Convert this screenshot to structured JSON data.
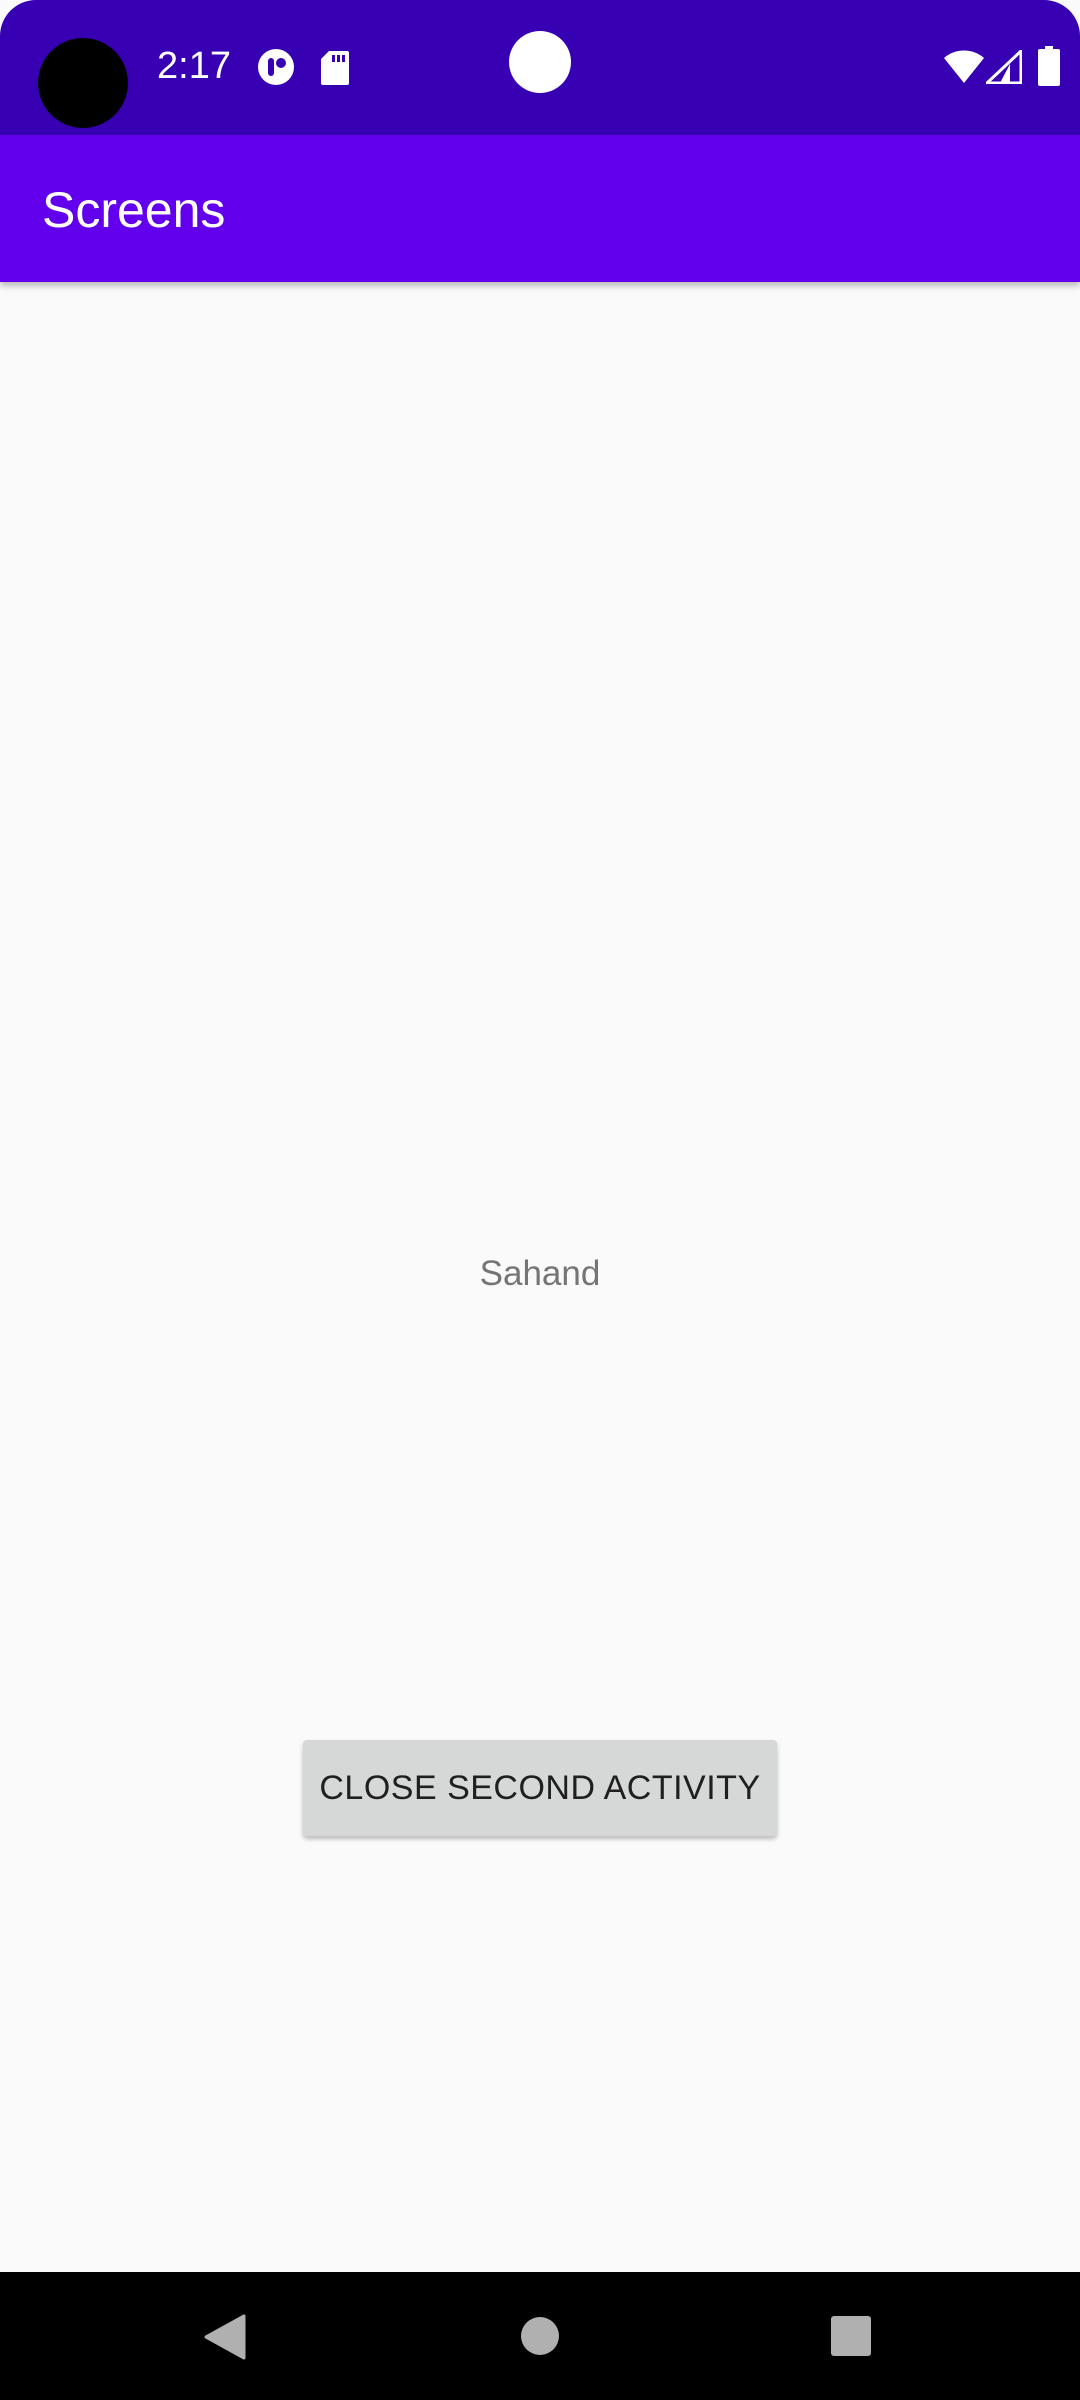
{
  "status_bar": {
    "time": "2:17",
    "background": "#3700b3",
    "icons": [
      "camera-cutout",
      "notification-app-icon",
      "sd-card-icon",
      "wifi-icon",
      "cell-signal-icon",
      "battery-icon"
    ]
  },
  "app_bar": {
    "title": "Screens",
    "background": "#6200ee"
  },
  "main": {
    "label": "Sahand",
    "close_button_label": "CLOSE SECOND ACTIVITY"
  },
  "nav_bar": {
    "buttons": [
      "back",
      "home",
      "recents"
    ]
  }
}
